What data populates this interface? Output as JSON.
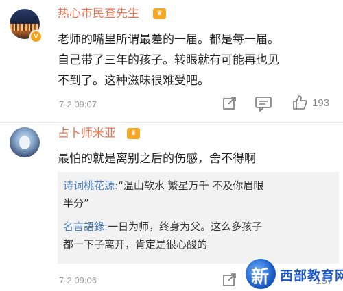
{
  "comments": [
    {
      "username": "热心市民查先生",
      "verified_badge": "V",
      "lines": [
        "老师的嘴里所谓最差的一届。都是每一届。",
        "自己带了三年的孩子。转眼就有可能再也见",
        "不到了。这种滋味很难受吧。"
      ],
      "time": "7-2 09:07",
      "likes": "193"
    },
    {
      "username": "占卜师米亚",
      "lines": [
        "最怕的就是离别之后的伤感，舍不得啊"
      ],
      "replies": [
        {
          "name": "诗词桃花源:",
          "lines": [
            "“温山软水 繁星万千 不及你眉眼",
            "半分”"
          ]
        },
        {
          "name": "名言語錄:",
          "lines": [
            "一日为师，终身为父。这么多孩子",
            "都一下子离开，肯定是很心酸的"
          ]
        }
      ],
      "time": "7-2 09:06",
      "likes": "157"
    }
  ],
  "watermark": {
    "char": "新",
    "text": "西部教育网"
  },
  "icons": {
    "share": "share-icon",
    "comment": "comment-icon",
    "like": "thumbs-up-icon",
    "crown": "crown-badge-icon"
  },
  "colors": {
    "username": "#eb7350",
    "reply_name": "#4a7ec2",
    "badge": "#f7a41b"
  }
}
